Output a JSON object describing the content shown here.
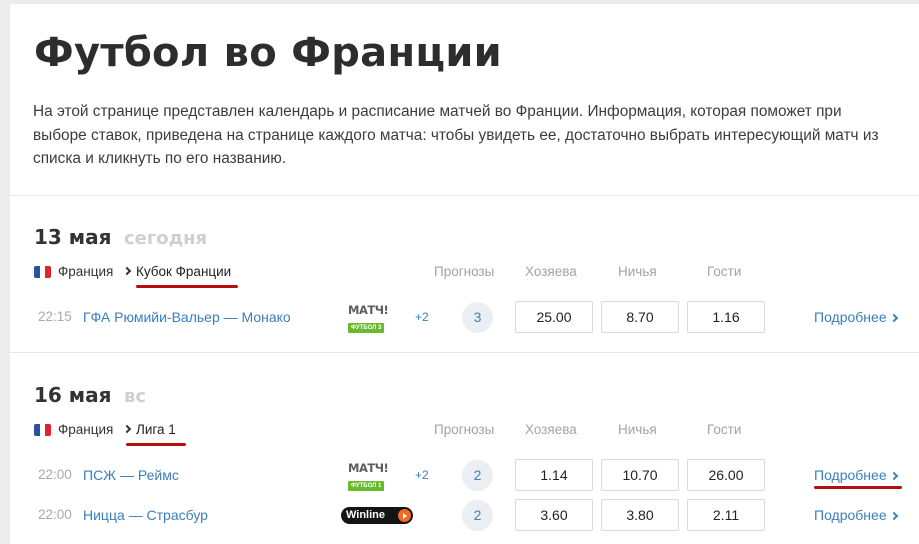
{
  "page": {
    "title": "Футбол во Франции",
    "intro": "На этой странице представлен календарь и расписание матчей во Франции. Информация, которая поможет при выборе ставок, приведена на странице каждого матча: чтобы увидеть ее, достаточно выбрать интересующий матч из списка и кликнуть по его названию."
  },
  "columns": {
    "forecasts": "Прогнозы",
    "home": "Хозяева",
    "draw": "Ничья",
    "away": "Гости"
  },
  "flag_colors": [
    "#2a50a1",
    "#ffffff",
    "#e1232f"
  ],
  "accent_underline": "#b40f0f",
  "link_color": "#3a7fbd",
  "days": [
    {
      "date": "13 мая",
      "weekday": "сегодня",
      "country": "Франция",
      "tournament": "Кубок Франции",
      "matches": [
        {
          "time": "22:15",
          "teams": "ГФА Рюмийи-Вальер — Монако",
          "broadcaster": {
            "top": "МАТЧ!",
            "bottom": "ФУТБОЛ 3",
            "icon": "match-tv-logo"
          },
          "extra_channels": "+2",
          "forecasts": "3",
          "odds": {
            "home": "25.00",
            "draw": "8.70",
            "away": "1.16"
          },
          "more": "Подробнее"
        }
      ]
    },
    {
      "date": "16 мая",
      "weekday": "вс",
      "country": "Франция",
      "tournament": "Лига 1",
      "matches": [
        {
          "time": "22:00",
          "teams": "ПСЖ — Реймс",
          "broadcaster": {
            "top": "МАТЧ!",
            "bottom": "ФУТБОЛ 1",
            "icon": "match-tv-logo"
          },
          "extra_channels": "+2",
          "forecasts": "2",
          "odds": {
            "home": "1.14",
            "draw": "10.70",
            "away": "26.00"
          },
          "more": "Подробнее"
        },
        {
          "time": "22:00",
          "teams": "Ницца — Страсбур",
          "broadcaster": {
            "label": "Winline",
            "icon": "winline-logo"
          },
          "forecasts": "2",
          "odds": {
            "home": "3.60",
            "draw": "3.80",
            "away": "2.11"
          },
          "more": "Подробнее"
        }
      ]
    }
  ]
}
